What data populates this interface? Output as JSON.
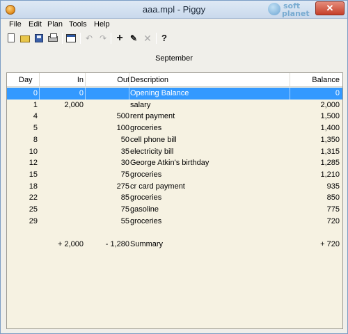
{
  "window": {
    "title": "aaa.mpl - Piggy",
    "close_glyph": "✕",
    "watermark_line1": "soft",
    "watermark_line2": "planet"
  },
  "menu": {
    "file": "File",
    "edit": "Edit",
    "plan": "Plan",
    "tools": "Tools",
    "help": "Help"
  },
  "toolbar": {
    "icons": [
      "new-document-icon",
      "open-folder-icon",
      "save-icon",
      "print-icon",
      "properties-icon",
      "undo-icon",
      "redo-icon",
      "add-icon",
      "edit-pencil-icon",
      "delete-icon",
      "help-icon"
    ],
    "undo_glyph": "↶",
    "redo_glyph": "↷",
    "add_glyph": "+",
    "edit_glyph": "✎",
    "delete_glyph": "✕",
    "help_glyph": "?"
  },
  "heading": "September",
  "columns": {
    "day": "Day",
    "in": "In",
    "out": "Out",
    "description": "Description",
    "balance": "Balance"
  },
  "rows": [
    {
      "day": "0",
      "in": "0",
      "out": "",
      "description": "Opening Balance",
      "balance": "0",
      "selected": true
    },
    {
      "day": "1",
      "in": "2,000",
      "out": "",
      "description": "salary",
      "balance": "2,000"
    },
    {
      "day": "4",
      "in": "",
      "out": "500",
      "description": "rent payment",
      "balance": "1,500"
    },
    {
      "day": "5",
      "in": "",
      "out": "100",
      "description": "groceries",
      "balance": "1,400"
    },
    {
      "day": "8",
      "in": "",
      "out": "50",
      "description": "cell phone bill",
      "balance": "1,350"
    },
    {
      "day": "10",
      "in": "",
      "out": "35",
      "description": "electricity bill",
      "balance": "1,315"
    },
    {
      "day": "12",
      "in": "",
      "out": "30",
      "description": "George Atkin's birthday",
      "balance": "1,285"
    },
    {
      "day": "15",
      "in": "",
      "out": "75",
      "description": "groceries",
      "balance": "1,210"
    },
    {
      "day": "18",
      "in": "",
      "out": "275",
      "description": "cr card payment",
      "balance": "935"
    },
    {
      "day": "22",
      "in": "",
      "out": "85",
      "description": "groceries",
      "balance": "850"
    },
    {
      "day": "25",
      "in": "",
      "out": "75",
      "description": "gasoline",
      "balance": "775"
    },
    {
      "day": "29",
      "in": "",
      "out": "55",
      "description": "groceries",
      "balance": "720"
    }
  ],
  "summary": {
    "in": "+ 2,000",
    "out": "- 1,280",
    "description": "Summary",
    "balance": "+ 720"
  },
  "colors": {
    "selection": "#3399ff",
    "ledger_background": "#f6f2e2"
  }
}
